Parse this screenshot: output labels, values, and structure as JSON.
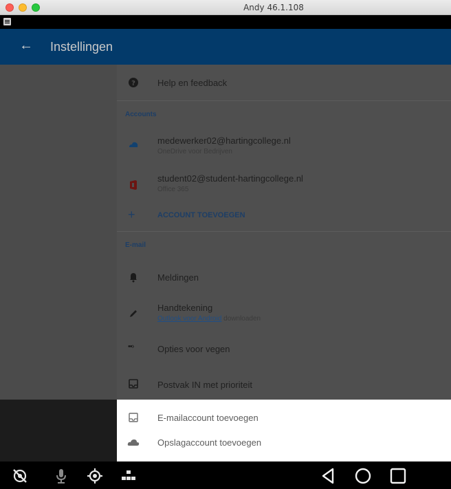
{
  "window": {
    "title": "Andy 46.1.108"
  },
  "appbar": {
    "title": "Instellingen"
  },
  "help": {
    "label": "Help en feedback"
  },
  "accounts": {
    "header": "Accounts",
    "items": [
      {
        "email": "medewerker02@hartingcollege.nl",
        "service": "OneDrive voor Bedrijven",
        "icon": "onedrive-icon"
      },
      {
        "email": "student02@student-hartingcollege.nl",
        "service": "Office 365",
        "icon": "office-icon"
      }
    ],
    "add_label": "ACCOUNT TOEVOEGEN"
  },
  "email": {
    "header": "E-mail",
    "meldingen": "Meldingen",
    "handtekening": "Handtekening",
    "handtekening_link": "Outlook voor Android",
    "handtekening_suffix": "downloaden",
    "vegen": "Opties voor vegen",
    "postvak": "Postvak IN met prioriteit"
  },
  "sheet": {
    "items": [
      {
        "label": "E-mailaccount toevoegen",
        "icon": "inbox-icon"
      },
      {
        "label": "Opslagaccount toevoegen",
        "icon": "cloud-icon"
      }
    ]
  },
  "colors": {
    "appbar": "#033a6a",
    "section_header": "#1d3e66",
    "onedrive": "#12416f",
    "office": "#6b1512"
  }
}
